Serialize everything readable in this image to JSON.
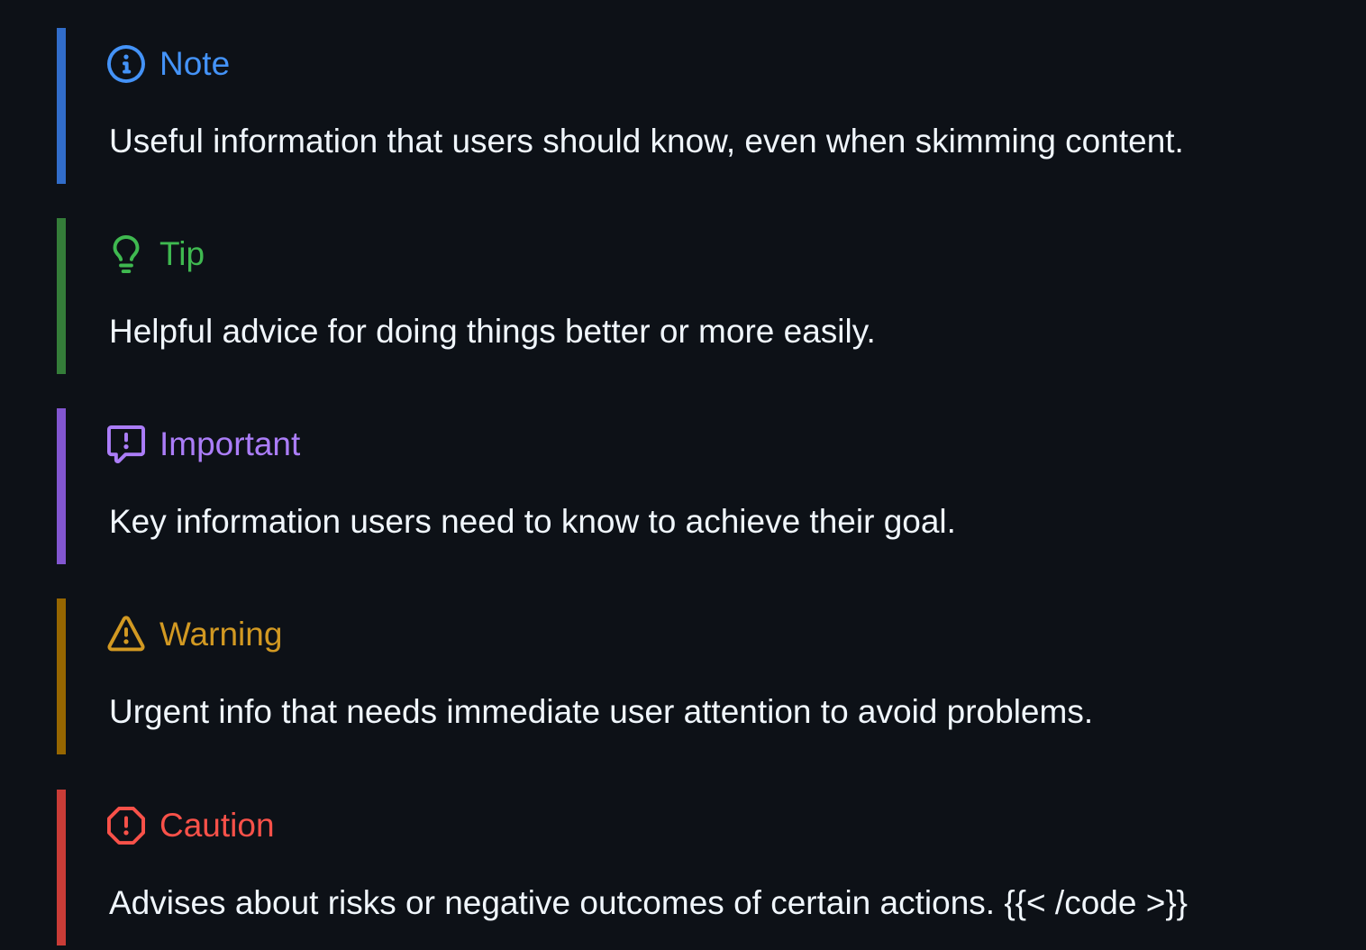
{
  "alerts": [
    {
      "kind": "note",
      "title": "Note",
      "body": "Useful information that users should know, even when skimming content.",
      "color": "#4493f8",
      "border_color": "#316dca",
      "icon": "info-icon"
    },
    {
      "kind": "tip",
      "title": "Tip",
      "body": "Helpful advice for doing things better or more easily.",
      "color": "#3fb950",
      "border_color": "#347d39",
      "icon": "lightbulb-icon"
    },
    {
      "kind": "important",
      "title": "Important",
      "body": "Key information users need to know to achieve their goal.",
      "color": "#ab7df8",
      "border_color": "#8256d0",
      "icon": "report-icon"
    },
    {
      "kind": "warning",
      "title": "Warning",
      "body": "Urgent info that needs immediate user attention to avoid problems.",
      "color": "#d29922",
      "border_color": "#966600",
      "icon": "alert-triangle-icon"
    },
    {
      "kind": "caution",
      "title": "Caution",
      "body": "Advises about risks or negative outcomes of certain actions. {{< /code >}}",
      "color": "#f85149",
      "border_color": "#c93c37",
      "icon": "stop-icon"
    }
  ]
}
